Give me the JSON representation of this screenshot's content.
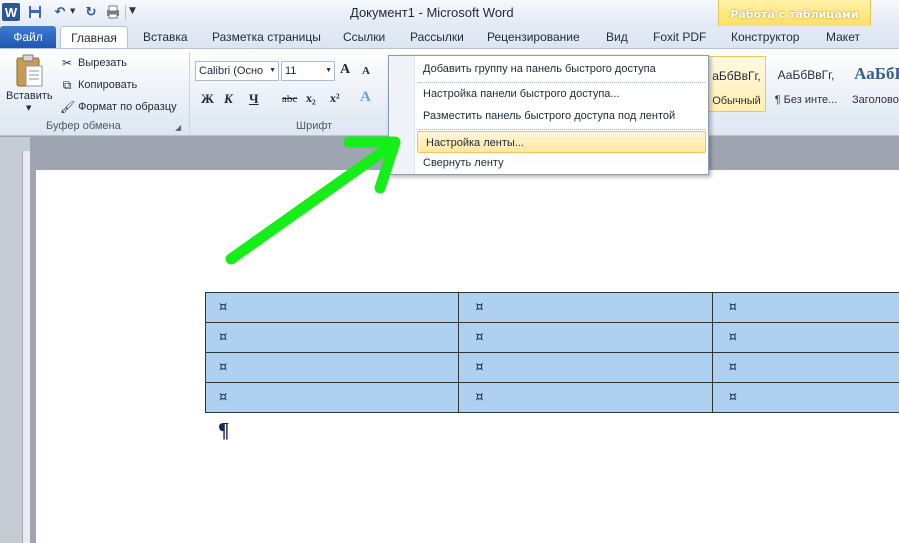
{
  "window": {
    "title": "Документ1 - Microsoft Word",
    "contextual_tab_group": "Работа с таблицами",
    "app_icon_letter": "W"
  },
  "tabs": {
    "file": "Файл",
    "home": "Главная",
    "insert": "Вставка",
    "page_layout": "Разметка страницы",
    "references": "Ссылки",
    "mailings": "Рассылки",
    "review": "Рецензирование",
    "view": "Вид",
    "foxit": "Foxit PDF",
    "design": "Конструктор",
    "layout": "Макет"
  },
  "ribbon": {
    "clipboard": {
      "paste_label": "Вставить",
      "cut_label": "Вырезать",
      "copy_label": "Копировать",
      "format_painter_label": "Формат по образцу",
      "group_label": "Буфер обмена"
    },
    "font": {
      "font_name": "Calibri (Осно",
      "font_size": "11",
      "grow_label": "A",
      "shrink_label": "A",
      "bold": "Ж",
      "italic": "К",
      "underline": "Ч",
      "strike": "abc",
      "subscript": "x₂",
      "superscript": "x²",
      "group_label": "Шрифт"
    },
    "styles": {
      "normal_sample": "аБбВвГг,",
      "normal_name": "Обычный",
      "nospacing_sample": "АаБбВвГг,",
      "nospacing_name": "¶ Без инте...",
      "heading1_sample": "АаБбВ",
      "heading1_name": "Заголово..."
    }
  },
  "context_menu": {
    "items": [
      "Добавить группу на панель быстрого доступа",
      "Настройка панели быстрого доступа...",
      "Разместить панель быстрого доступа под лентой",
      "Настройка ленты...",
      "Свернуть ленту"
    ]
  },
  "document": {
    "cell_mark": "¤",
    "paragraph_mark": "¶",
    "rows": 4,
    "cols": 3
  },
  "colors": {
    "highlight_arrow": "#16ee1a",
    "table_selection": "#aed1f1",
    "file_tab": "#2a63c0",
    "contextual_tab": "#ffe066"
  }
}
